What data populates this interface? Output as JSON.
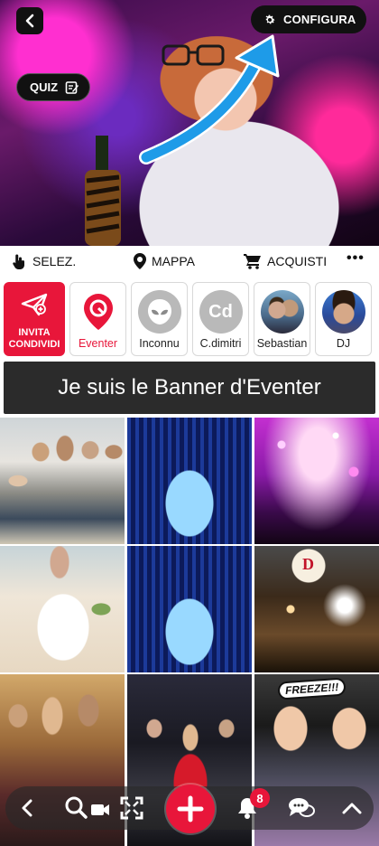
{
  "hero": {
    "config_label": "CONFIGURA",
    "quiz_label": "QUIZ",
    "arrow_color": "#1e9be8"
  },
  "actionbar": {
    "select_label": "SELEZ.",
    "map_label": "MAPPA",
    "purchases_label": "ACQUISTI",
    "more_label": "•••"
  },
  "contacts": {
    "invite_line1": "INVITA",
    "invite_line2": "CONDIVIDI",
    "items": [
      {
        "label": "Eventer"
      },
      {
        "label": "Inconnu"
      },
      {
        "label": "C.dimitri",
        "initials": "Cd"
      },
      {
        "label": "Sebastian"
      },
      {
        "label": "DJ"
      }
    ]
  },
  "banner": {
    "text": "Je suis le Banner d'Eventer"
  },
  "grid": {
    "freeze_text": "FREEZE!!!",
    "balloon_letter": "D"
  },
  "bottomnav": {
    "notification_count": "8"
  },
  "colors": {
    "accent": "#e8163a",
    "dark": "#111111",
    "banner_bg": "#2b2b2b"
  }
}
